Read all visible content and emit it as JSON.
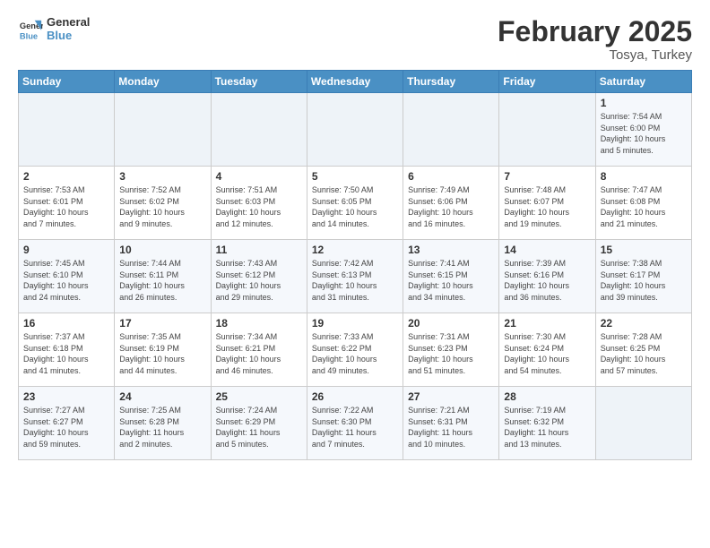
{
  "logo": {
    "line1": "General",
    "line2": "Blue"
  },
  "title": "February 2025",
  "subtitle": "Tosya, Turkey",
  "days_of_week": [
    "Sunday",
    "Monday",
    "Tuesday",
    "Wednesday",
    "Thursday",
    "Friday",
    "Saturday"
  ],
  "weeks": [
    [
      {
        "day": "",
        "info": ""
      },
      {
        "day": "",
        "info": ""
      },
      {
        "day": "",
        "info": ""
      },
      {
        "day": "",
        "info": ""
      },
      {
        "day": "",
        "info": ""
      },
      {
        "day": "",
        "info": ""
      },
      {
        "day": "1",
        "info": "Sunrise: 7:54 AM\nSunset: 6:00 PM\nDaylight: 10 hours\nand 5 minutes."
      }
    ],
    [
      {
        "day": "2",
        "info": "Sunrise: 7:53 AM\nSunset: 6:01 PM\nDaylight: 10 hours\nand 7 minutes."
      },
      {
        "day": "3",
        "info": "Sunrise: 7:52 AM\nSunset: 6:02 PM\nDaylight: 10 hours\nand 9 minutes."
      },
      {
        "day": "4",
        "info": "Sunrise: 7:51 AM\nSunset: 6:03 PM\nDaylight: 10 hours\nand 12 minutes."
      },
      {
        "day": "5",
        "info": "Sunrise: 7:50 AM\nSunset: 6:05 PM\nDaylight: 10 hours\nand 14 minutes."
      },
      {
        "day": "6",
        "info": "Sunrise: 7:49 AM\nSunset: 6:06 PM\nDaylight: 10 hours\nand 16 minutes."
      },
      {
        "day": "7",
        "info": "Sunrise: 7:48 AM\nSunset: 6:07 PM\nDaylight: 10 hours\nand 19 minutes."
      },
      {
        "day": "8",
        "info": "Sunrise: 7:47 AM\nSunset: 6:08 PM\nDaylight: 10 hours\nand 21 minutes."
      }
    ],
    [
      {
        "day": "9",
        "info": "Sunrise: 7:45 AM\nSunset: 6:10 PM\nDaylight: 10 hours\nand 24 minutes."
      },
      {
        "day": "10",
        "info": "Sunrise: 7:44 AM\nSunset: 6:11 PM\nDaylight: 10 hours\nand 26 minutes."
      },
      {
        "day": "11",
        "info": "Sunrise: 7:43 AM\nSunset: 6:12 PM\nDaylight: 10 hours\nand 29 minutes."
      },
      {
        "day": "12",
        "info": "Sunrise: 7:42 AM\nSunset: 6:13 PM\nDaylight: 10 hours\nand 31 minutes."
      },
      {
        "day": "13",
        "info": "Sunrise: 7:41 AM\nSunset: 6:15 PM\nDaylight: 10 hours\nand 34 minutes."
      },
      {
        "day": "14",
        "info": "Sunrise: 7:39 AM\nSunset: 6:16 PM\nDaylight: 10 hours\nand 36 minutes."
      },
      {
        "day": "15",
        "info": "Sunrise: 7:38 AM\nSunset: 6:17 PM\nDaylight: 10 hours\nand 39 minutes."
      }
    ],
    [
      {
        "day": "16",
        "info": "Sunrise: 7:37 AM\nSunset: 6:18 PM\nDaylight: 10 hours\nand 41 minutes."
      },
      {
        "day": "17",
        "info": "Sunrise: 7:35 AM\nSunset: 6:19 PM\nDaylight: 10 hours\nand 44 minutes."
      },
      {
        "day": "18",
        "info": "Sunrise: 7:34 AM\nSunset: 6:21 PM\nDaylight: 10 hours\nand 46 minutes."
      },
      {
        "day": "19",
        "info": "Sunrise: 7:33 AM\nSunset: 6:22 PM\nDaylight: 10 hours\nand 49 minutes."
      },
      {
        "day": "20",
        "info": "Sunrise: 7:31 AM\nSunset: 6:23 PM\nDaylight: 10 hours\nand 51 minutes."
      },
      {
        "day": "21",
        "info": "Sunrise: 7:30 AM\nSunset: 6:24 PM\nDaylight: 10 hours\nand 54 minutes."
      },
      {
        "day": "22",
        "info": "Sunrise: 7:28 AM\nSunset: 6:25 PM\nDaylight: 10 hours\nand 57 minutes."
      }
    ],
    [
      {
        "day": "23",
        "info": "Sunrise: 7:27 AM\nSunset: 6:27 PM\nDaylight: 10 hours\nand 59 minutes."
      },
      {
        "day": "24",
        "info": "Sunrise: 7:25 AM\nSunset: 6:28 PM\nDaylight: 11 hours\nand 2 minutes."
      },
      {
        "day": "25",
        "info": "Sunrise: 7:24 AM\nSunset: 6:29 PM\nDaylight: 11 hours\nand 5 minutes."
      },
      {
        "day": "26",
        "info": "Sunrise: 7:22 AM\nSunset: 6:30 PM\nDaylight: 11 hours\nand 7 minutes."
      },
      {
        "day": "27",
        "info": "Sunrise: 7:21 AM\nSunset: 6:31 PM\nDaylight: 11 hours\nand 10 minutes."
      },
      {
        "day": "28",
        "info": "Sunrise: 7:19 AM\nSunset: 6:32 PM\nDaylight: 11 hours\nand 13 minutes."
      },
      {
        "day": "",
        "info": ""
      }
    ]
  ]
}
